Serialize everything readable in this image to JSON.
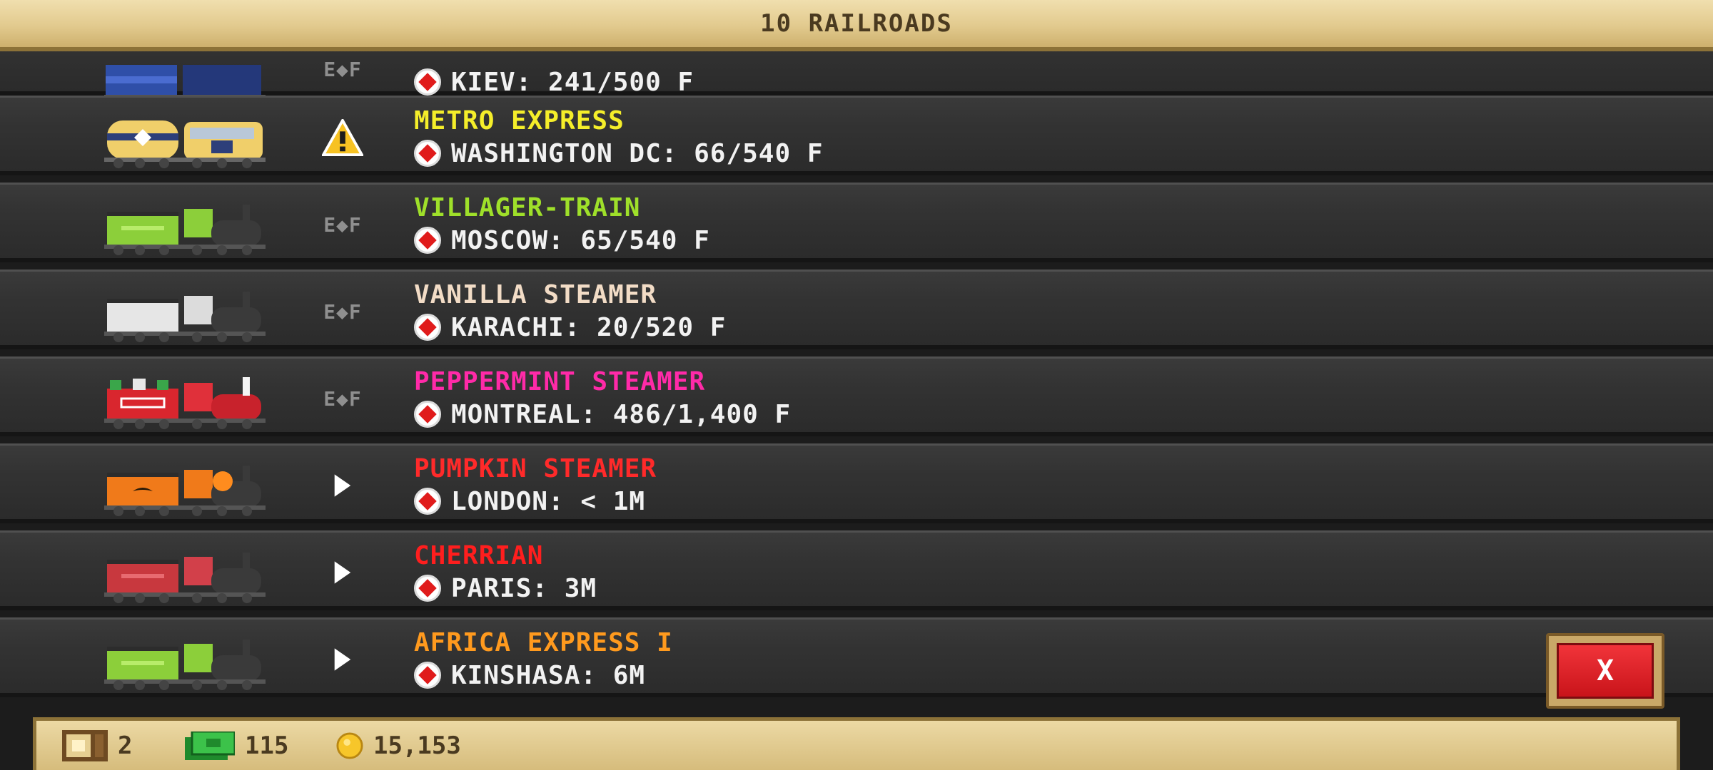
{
  "header": {
    "title": "10 RAILROADS"
  },
  "colors": {
    "metro_express": "#f5ee2a",
    "villager_train": "#9fe02a",
    "vanilla_steamer": "#f2dcc6",
    "peppermint_steamer": "#ff2aa8",
    "pumpkin_steamer": "#ff2a2a",
    "cherrian": "#ff1e1e",
    "africa_express": "#ff9a1e"
  },
  "status_labels": {
    "empty_full": "E◆F"
  },
  "rows": [
    {
      "name": "",
      "destination": "KIEV: 241/500 F",
      "status": "empty-full",
      "train": "blue"
    },
    {
      "name": "METRO EXPRESS",
      "destination": "WASHINGTON DC: 66/540 F",
      "status": "warning",
      "train": "metro"
    },
    {
      "name": "VILLAGER-TRAIN",
      "destination": "MOSCOW: 65/540 F",
      "status": "empty-full",
      "train": "green"
    },
    {
      "name": "VANILLA STEAMER",
      "destination": "KARACHI: 20/520 F",
      "status": "empty-full",
      "train": "white"
    },
    {
      "name": "PEPPERMINT STEAMER",
      "destination": "MONTREAL: 486/1,400 F",
      "status": "empty-full",
      "train": "peppermint"
    },
    {
      "name": "PUMPKIN STEAMER",
      "destination": "LONDON: < 1M",
      "status": "play",
      "train": "pumpkin"
    },
    {
      "name": "CHERRIAN",
      "destination": "PARIS: 3M",
      "status": "play",
      "train": "cherry"
    },
    {
      "name": "AFRICA EXPRESS I",
      "destination": "KINSHASA: 6M",
      "status": "play",
      "train": "green"
    }
  ],
  "close_button": {
    "label": "X"
  },
  "footer": {
    "crates": "2",
    "cash": "115",
    "coins": "15,153"
  }
}
